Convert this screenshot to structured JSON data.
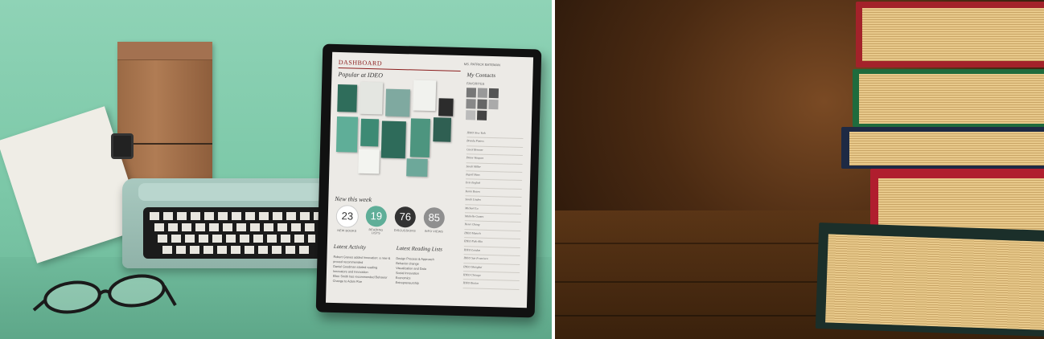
{
  "left_photo": {
    "subject": "typewriter-and-tablet",
    "tablet_screen": {
      "header": "DASHBOARD",
      "user_name": "MS. PATRICK BATEMAN",
      "popular_title": "Popular at IDEO",
      "contacts_title": "My Contacts",
      "favorites_label": "FAVORITES",
      "contacts": [
        "IDEO New York",
        "Brenda Pieters",
        "Carol Brenner",
        "Diane Vasquez",
        "Sarah Miller",
        "Ingrid Haas",
        "Erin English",
        "Karin Rosen",
        "Sarah Linden",
        "Michael Lo",
        "Michelle Gomes",
        "Henri Chang",
        "IDEO Munich",
        "IDEO Palo Alto",
        "IDEO London",
        "IDEO San Francisco",
        "IDEO Shanghai",
        "IDEO Chicago",
        "IDEO Boston"
      ],
      "new_this_week_title": "New this week",
      "stats": [
        {
          "value": "23",
          "label": "NEW BOOKS"
        },
        {
          "value": "19",
          "label": "READING LISTS"
        },
        {
          "value": "76",
          "label": "DISCUSSIONS"
        },
        {
          "value": "85",
          "label": "INFO VIEWS"
        }
      ],
      "latest_activity_title": "Latest Activity",
      "latest_activity_items": [
        "Robert Graves added Innovation: a new & proved recommended",
        "Daniel Goodman started reading Innovators and Innovation",
        "Ellen Smith has recommended Behavior Change to Adam Roe"
      ],
      "reading_lists_title": "Latest Reading Lists",
      "reading_lists_items": [
        "Design Process & Approach",
        "Behavior change",
        "Visualization and Data",
        "Social Innovation",
        "Economics",
        "Entrepreneurship"
      ]
    }
  },
  "right_photo": {
    "subject": "stack-of-old-books-on-wooden-table"
  },
  "colors": {
    "mint_background": "#8fd3b6",
    "wood_dark": "#3a210c",
    "dashboard_red": "#8b1c1c",
    "stat_teal": "#5fae98"
  }
}
